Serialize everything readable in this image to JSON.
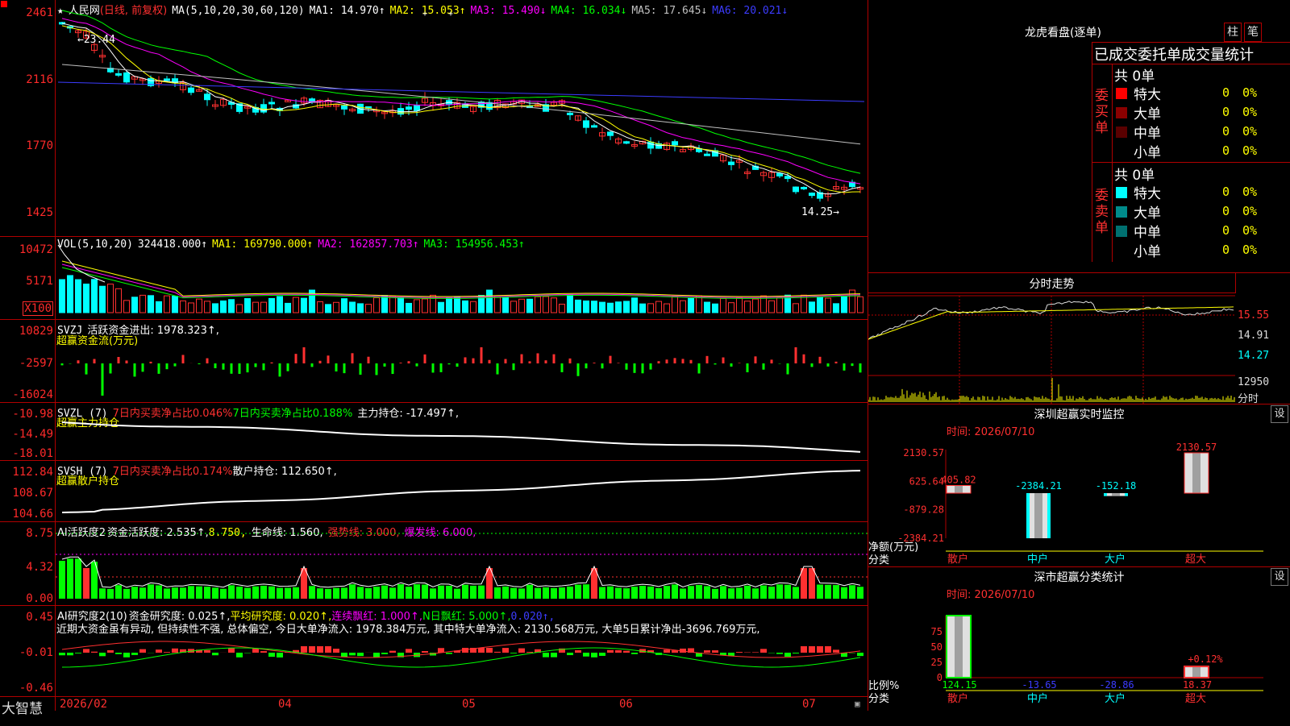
{
  "stock": {
    "name": "人民网",
    "mode": "(日线, 前复权)",
    "star_icon": "star-icon"
  },
  "price_panel": {
    "ma_legend": "MA(5,10,20,30,60,120)",
    "ma_values": [
      {
        "label": "MA1: 14.970↑",
        "color": "#ffffff"
      },
      {
        "label": "MA2: 15.053↑",
        "color": "#ffff00"
      },
      {
        "label": "MA3: 15.490↓",
        "color": "#ff00ff"
      },
      {
        "label": "MA4: 16.034↓",
        "color": "#00ff00"
      },
      {
        "label": "MA5: 17.645↓",
        "color": "#c0c0c0"
      },
      {
        "label": "MA6: 20.021↓",
        "color": "#3c3cff"
      }
    ],
    "y_ticks": [
      "2461",
      "2116",
      "1770",
      "1425"
    ],
    "high_marker": "←23.44",
    "low_marker": "14.25→"
  },
  "vol_panel": {
    "legend": "VOL(5,10,20)",
    "values": [
      {
        "label": "324418.000↑",
        "color": "#ffffff"
      },
      {
        "label": "MA1: 169790.000↑",
        "color": "#ffff00"
      },
      {
        "label": "MA2: 162857.703↑",
        "color": "#ff00ff"
      },
      {
        "label": "MA3: 154956.453↑",
        "color": "#00ff00"
      }
    ],
    "y_ticks": [
      "10472",
      "5171"
    ],
    "unit": "X100"
  },
  "svzj_panel": {
    "legend": "SVZJ",
    "line1": "活跃资金进出: 1978.323↑,",
    "line2": "超赢资金流(万元)",
    "y_ticks": [
      "10829",
      "-2597",
      "-16024"
    ]
  },
  "svzl_panel": {
    "legend": "SVZL (7)",
    "val1": "7日内买卖净占比0.046%",
    "val2": "7日内买卖净占比0.188%",
    "val3": "主力持仓: -17.497↑,",
    "line2": "超赢主力持仓",
    "y_ticks": [
      "-10.98",
      "-14.49",
      "-18.01"
    ]
  },
  "svsh_panel": {
    "legend": "SVSH (7)",
    "val1": "7日内买卖净占比0.174%",
    "val2": "散户持仓: 112.650↑,",
    "line2": "超赢散户持仓",
    "y_ticks": [
      "112.84",
      "108.67",
      "104.66"
    ]
  },
  "ai_active_panel": {
    "legend": "AI活跃度2",
    "v1": "资金活跃度: 2.535↑,",
    "v2": "8.750,",
    "v3": "生命线: 1.560,",
    "v4": "强势线: 3.000,",
    "v5": "爆发线: 6.000,",
    "y_ticks": [
      "8.75",
      "4.32",
      "0.00"
    ]
  },
  "ai_research_panel": {
    "legend": "AI研究度2(10)",
    "v1": "资金研究度: 0.025↑,",
    "v2": "平均研究度: 0.020↑,",
    "v3": "连续飘红: 1.000↑,",
    "v4": "N日飘红: 5.000↑,",
    "v5": "0.020↑,",
    "comment": "近期大资金虽有异动, 但持续性不强, 总体偏空, 今日大单净流入: 1978.384万元, 其中特大单净流入: 2130.568万元, 大单5日累计净出-3696.769万元,",
    "y_ticks": [
      "0.45",
      "-0.01",
      "-0.46"
    ]
  },
  "x_axis": {
    "brand": "大智慧",
    "labels": [
      "2026/02",
      "04",
      "05",
      "06",
      "07"
    ]
  },
  "dragon_panel": {
    "title": "龙虎看盘(逐单)",
    "tab_bar": "柱",
    "tab_stroke": "笔",
    "header": "已成交委托单成交量统计",
    "buy_label": "委买单",
    "sell_label": "委卖单",
    "buy_total": "共 0单",
    "sell_total": "共 0单",
    "buy_rows": [
      {
        "name": "特大",
        "value": "0",
        "pct": "0%",
        "color": "#ff0000"
      },
      {
        "name": "大单",
        "value": "0",
        "pct": "0%",
        "color": "#8b0000"
      },
      {
        "name": "中单",
        "value": "0",
        "pct": "0%",
        "color": "#5a0000"
      },
      {
        "name": "小单",
        "value": "0",
        "pct": "0%",
        "color": ""
      }
    ],
    "sell_rows": [
      {
        "name": "特大",
        "value": "0",
        "pct": "0%",
        "color": "#00ffff"
      },
      {
        "name": "大单",
        "value": "0",
        "pct": "0%",
        "color": "#008b8b"
      },
      {
        "name": "中单",
        "value": "0",
        "pct": "0%",
        "color": "#007070"
      },
      {
        "name": "小单",
        "value": "0",
        "pct": "0%",
        "color": ""
      }
    ]
  },
  "intraday_panel": {
    "title": "分时走势",
    "y_ticks": [
      "15.55",
      "14.91",
      "14.27"
    ],
    "vol_tick": "12950",
    "unit": "分时"
  },
  "monitor_panel": {
    "title": "深圳超赢实时监控",
    "settings": "设",
    "time": "时间: 2026/07/10",
    "y_ticks": [
      "2130.57",
      "625.64",
      "-879.28",
      "-2384.21"
    ],
    "y_unit": "净额(万元)",
    "x_unit": "分类",
    "categories": [
      "散户",
      "中户",
      "大户",
      "超大"
    ],
    "values": [
      405.82,
      -2384.21,
      -152.18,
      2130.57
    ],
    "value_labels": [
      "405.82",
      "-2384.21",
      "-152.18",
      "2130.57"
    ]
  },
  "stats_panel": {
    "title": "深市超赢分类统计",
    "settings": "设",
    "time": "时间: 2026/07/10",
    "y_ticks": [
      "75",
      "50",
      "25",
      "0"
    ],
    "y_unit": "比例%",
    "x_unit": "分类",
    "categories": [
      "散户",
      "中户",
      "大户",
      "超大"
    ],
    "values": [
      124.15,
      -13.65,
      -28.86,
      18.37
    ],
    "value_labels": [
      "124.15",
      "-13.65",
      "-28.86",
      "18.37"
    ],
    "bar_note": "+0.12%"
  },
  "colors": {
    "frame": "#b00000",
    "up": "#ff3030",
    "down": "#00ffff",
    "green": "#00ff00",
    "yellow": "#ffff00"
  }
}
